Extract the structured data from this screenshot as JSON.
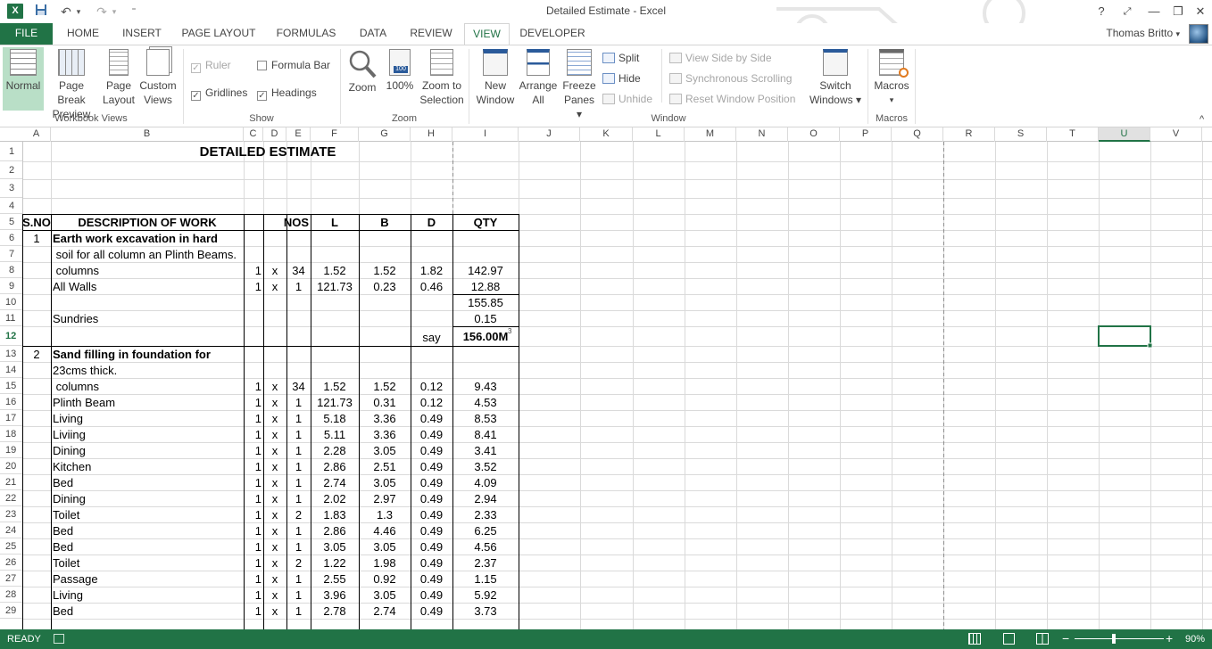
{
  "window": {
    "title": "Detailed Estimate - Excel",
    "app_icon": "X",
    "help": "?",
    "restore_ribbon": "⤢",
    "minimize": "—",
    "restore": "❐",
    "close": "✕"
  },
  "qat": {
    "save": "💾",
    "undo": "↶",
    "undo_drop": "▾",
    "redo": "↷",
    "redo_drop": "▾",
    "customize": "⁼"
  },
  "tabs": [
    "FILE",
    "HOME",
    "INSERT",
    "PAGE LAYOUT",
    "FORMULAS",
    "DATA",
    "REVIEW",
    "VIEW",
    "DEVELOPER"
  ],
  "active_tab": "VIEW",
  "user": {
    "name": "Thomas Britto",
    "dropdown": "▾"
  },
  "ribbon": {
    "workbook_views": {
      "label": "Workbook Views",
      "normal": "Normal",
      "page_break_1": "Page Break",
      "page_break_2": "Preview",
      "page_layout_1": "Page",
      "page_layout_2": "Layout",
      "custom_1": "Custom",
      "custom_2": "Views"
    },
    "show": {
      "label": "Show",
      "ruler": "Ruler",
      "formula_bar": "Formula Bar",
      "gridlines": "Gridlines",
      "headings": "Headings"
    },
    "zoom": {
      "label": "Zoom",
      "zoom": "Zoom",
      "hundred": "100%",
      "zoom_sel_1": "Zoom to",
      "zoom_sel_2": "Selection"
    },
    "window": {
      "label": "Window",
      "new_1": "New",
      "new_2": "Window",
      "arrange_1": "Arrange",
      "arrange_2": "All",
      "freeze_1": "Freeze",
      "freeze_2": "Panes ▾",
      "split": "Split",
      "hide": "Hide",
      "unhide": "Unhide",
      "side_by_side": "View Side by Side",
      "sync_scroll": "Synchronous Scrolling",
      "reset_pos": "Reset Window Position",
      "switch_1": "Switch",
      "switch_2": "Windows ▾"
    },
    "macros": {
      "label": "Macros",
      "macros": "Macros",
      "drop": "▾"
    },
    "collapse": "^"
  },
  "columns": [
    "A",
    "B",
    "C",
    "D",
    "E",
    "F",
    "G",
    "H",
    "I",
    "J",
    "K",
    "L",
    "M",
    "N",
    "O",
    "P",
    "Q",
    "R",
    "S",
    "T",
    "U",
    "V"
  ],
  "selected_column": "U",
  "rows": [
    "1",
    "2",
    "3",
    "4",
    "5",
    "6",
    "7",
    "8",
    "9",
    "10",
    "11",
    "12",
    "13",
    "14",
    "15",
    "16",
    "17",
    "18",
    "19",
    "20",
    "21",
    "22",
    "23",
    "24",
    "25",
    "26",
    "27",
    "28",
    "29"
  ],
  "selected_row": "12",
  "sheet": {
    "title": "DETAILED ESTIMATE",
    "header": {
      "sno": "S.NO",
      "desc": "DESCRIPTION OF WORK",
      "nos": "NOS",
      "l": "L",
      "b": "B",
      "d": "D",
      "qty": "QTY"
    },
    "r6": {
      "sno": "1",
      "desc": "Earth work excavation in hard"
    },
    "r7": {
      "desc": " soil for all column an Plinth Beams."
    },
    "r8": {
      "desc": " columns",
      "c": "1",
      "x": "x",
      "nos": "34",
      "l": "1.52",
      "b": "1.52",
      "d": "1.82",
      "qty": "142.97"
    },
    "r9": {
      "desc": "All Walls",
      "c": "1",
      "x": "x",
      "nos": "1",
      "l": "121.73",
      "b": "0.23",
      "d": "0.46",
      "qty": "12.88"
    },
    "r10": {
      "qty": "155.85"
    },
    "r11": {
      "desc": "Sundries",
      "qty": "0.15"
    },
    "r12": {
      "say": "say",
      "qty": "156.00M",
      "sup": "3"
    },
    "r13": {
      "sno": "2",
      "desc": "Sand filling in foundation for"
    },
    "r14": {
      "desc": "23cms thick."
    },
    "items": [
      {
        "row": 15,
        "desc": " columns",
        "c": "1",
        "x": "x",
        "nos": "34",
        "l": "1.52",
        "b": "1.52",
        "d": "0.12",
        "qty": "9.43"
      },
      {
        "row": 16,
        "desc": "Plinth Beam",
        "c": "1",
        "x": "x",
        "nos": "1",
        "l": "121.73",
        "b": "0.31",
        "d": "0.12",
        "qty": "4.53"
      },
      {
        "row": 17,
        "desc": "Living",
        "c": "1",
        "x": "x",
        "nos": "1",
        "l": "5.18",
        "b": "3.36",
        "d": "0.49",
        "qty": "8.53"
      },
      {
        "row": 18,
        "desc": "Liviing",
        "c": "1",
        "x": "x",
        "nos": "1",
        "l": "5.11",
        "b": "3.36",
        "d": "0.49",
        "qty": "8.41"
      },
      {
        "row": 19,
        "desc": "Dining",
        "c": "1",
        "x": "x",
        "nos": "1",
        "l": "2.28",
        "b": "3.05",
        "d": "0.49",
        "qty": "3.41"
      },
      {
        "row": 20,
        "desc": "Kitchen",
        "c": "1",
        "x": "x",
        "nos": "1",
        "l": "2.86",
        "b": "2.51",
        "d": "0.49",
        "qty": "3.52"
      },
      {
        "row": 21,
        "desc": "Bed",
        "c": "1",
        "x": "x",
        "nos": "1",
        "l": "2.74",
        "b": "3.05",
        "d": "0.49",
        "qty": "4.09"
      },
      {
        "row": 22,
        "desc": "Dining",
        "c": "1",
        "x": "x",
        "nos": "1",
        "l": "2.02",
        "b": "2.97",
        "d": "0.49",
        "qty": "2.94"
      },
      {
        "row": 23,
        "desc": "Toilet",
        "c": "1",
        "x": "x",
        "nos": "2",
        "l": "1.83",
        "b": "1.3",
        "d": "0.49",
        "qty": "2.33"
      },
      {
        "row": 24,
        "desc": "Bed",
        "c": "1",
        "x": "x",
        "nos": "1",
        "l": "2.86",
        "b": "4.46",
        "d": "0.49",
        "qty": "6.25"
      },
      {
        "row": 25,
        "desc": "Bed",
        "c": "1",
        "x": "x",
        "nos": "1",
        "l": "3.05",
        "b": "3.05",
        "d": "0.49",
        "qty": "4.56"
      },
      {
        "row": 26,
        "desc": "Toilet",
        "c": "1",
        "x": "x",
        "nos": "2",
        "l": "1.22",
        "b": "1.98",
        "d": "0.49",
        "qty": "2.37"
      },
      {
        "row": 27,
        "desc": "Passage",
        "c": "1",
        "x": "x",
        "nos": "1",
        "l": "2.55",
        "b": "0.92",
        "d": "0.49",
        "qty": "1.15"
      },
      {
        "row": 28,
        "desc": "Living",
        "c": "1",
        "x": "x",
        "nos": "1",
        "l": "3.96",
        "b": "3.05",
        "d": "0.49",
        "qty": "5.92"
      },
      {
        "row": 29,
        "desc": "Bed",
        "c": "1",
        "x": "x",
        "nos": "1",
        "l": "2.78",
        "b": "2.74",
        "d": "0.49",
        "qty": "3.73"
      }
    ]
  },
  "status": {
    "ready": "READY",
    "zoom": "90%",
    "minus": "−",
    "plus": "+"
  },
  "colors": {
    "accent": "#217346",
    "selection": "#217346"
  }
}
